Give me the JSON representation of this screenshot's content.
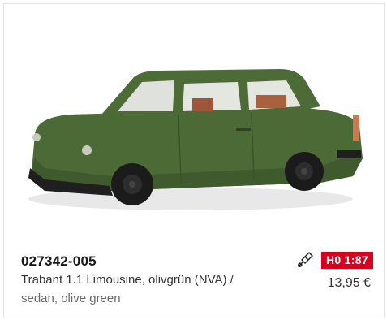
{
  "product": {
    "article_number": "027342-005",
    "description_de": "Trabant 1.1 Limousine, olivgrün (NVA) /",
    "description_en": "sedan, olive green",
    "scale_badge": "H0 1:87",
    "price": "13,95 €",
    "image_icon": "model-car-photo",
    "paint_icon": "paintbrush-icon"
  },
  "colors": {
    "badge_bg": "#d7001e",
    "car_body": "#4c6a35",
    "card_border": "#e3e3e3"
  }
}
